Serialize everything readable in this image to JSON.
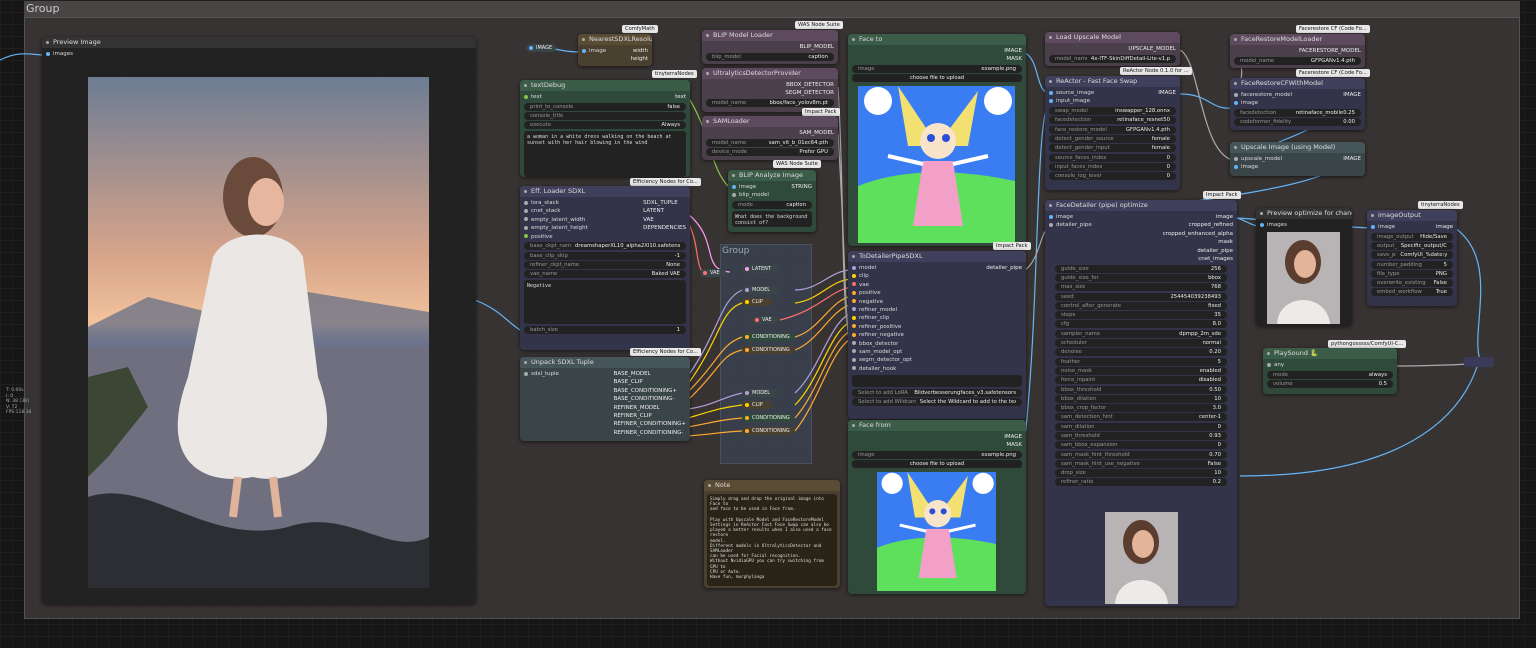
{
  "group_outer": "Group",
  "group_inner": "Group",
  "side_stats": [
    "T: 0.00s",
    "I: 0",
    "N: 38 [38]",
    "V: 72",
    "FPS:118.34"
  ],
  "preview_image": {
    "title": "Preview Image",
    "input": "images"
  },
  "nearest": {
    "title": "NearestSDXLResolution",
    "badge": "ComfyMath",
    "in_image": "image",
    "out_width": "width",
    "out_height": "height"
  },
  "image_reroute": "IMAGE",
  "textdebug": {
    "title": "textDebug",
    "badge": "tinyterraNodes",
    "in": "text",
    "out": "text",
    "widgets": [
      [
        "print_to_console",
        "false"
      ],
      [
        "console_title",
        ""
      ],
      [
        "execute",
        "Always"
      ]
    ],
    "text": "a woman in a white dress walking on the beach at sunset with her hair blowing in the wind"
  },
  "eff_loader": {
    "title": "Eff. Loader SDXL",
    "badge": "Efficiency Nodes for Co...",
    "inputs": [
      "lora_stack",
      "cnet_stack",
      "empty_latent_width",
      "empty_latent_height",
      "positive"
    ],
    "outputs": [
      "SDXL_TUPLE",
      "LATENT",
      "VAE",
      "DEPENDENCIES"
    ],
    "widgets": [
      [
        "base_ckpt_name",
        "dreamshaperXL10_alpha2Xl10.safetensors"
      ],
      [
        "base_clip_skip",
        "-1"
      ],
      [
        "refiner_ckpt_name",
        "None"
      ],
      [
        "vae_name",
        "Baked VAE"
      ]
    ],
    "negative": "Negative",
    "batch": [
      "batch_size",
      "1"
    ]
  },
  "unpack": {
    "title": "Unpack SDXL Tuple",
    "badge": "Efficiency Nodes for Co...",
    "input": "sdxl_tuple",
    "outputs": [
      "BASE_MODEL",
      "BASE_CLIP",
      "BASE_CONDITIONING+",
      "BASE_CONDITIONING-",
      "REFINER_MODEL",
      "REFINER_CLIP",
      "REFINER_CONDITIONING+",
      "REFINER_CONDITIONING-"
    ]
  },
  "vae_reroute": "VAE",
  "inner_reroutes": [
    "LATENT",
    "MODEL",
    "CLIP",
    "VAE",
    "CONDITIONING",
    "CONDITIONING",
    "MODEL",
    "CLIP",
    "CONDITIONING",
    "CONDITIONING"
  ],
  "blip_loader": {
    "title": "BLIP Model Loader",
    "badge": "WAS Node Suite",
    "out": "BLIP_MODEL",
    "widgets": [
      [
        "blip_model",
        "caption"
      ]
    ]
  },
  "ultra": {
    "title": "UltralyticsDetectorProvider",
    "outputs": [
      "BBOX_DETECTOR",
      "SEGM_DETECTOR"
    ],
    "widgets": [
      [
        "model_name",
        "bbox/face_yolov8m.pt"
      ]
    ],
    "badge": "Impact Pack"
  },
  "samloader": {
    "title": "SAMLoader",
    "out": "SAM_MODEL",
    "widgets": [
      [
        "model_name",
        "sam_vit_b_01ec64.pth"
      ],
      [
        "device_mode",
        "Prefer GPU"
      ]
    ],
    "badge": "WAS Node Suite"
  },
  "blip_analyze": {
    "title": "BLIP Analyze Image",
    "inputs": [
      "image",
      "blip_model"
    ],
    "out": "STRING",
    "widgets": [
      [
        "mode",
        "caption"
      ]
    ],
    "text": "What does the background consist of?"
  },
  "face_to": {
    "title": "Face to",
    "outputs": [
      "IMAGE",
      "MASK"
    ],
    "widget": [
      "image",
      "example.png"
    ],
    "button": "choose file to upload"
  },
  "todetailer": {
    "title": "ToDetailerPipeSDXL",
    "badge": "Impact Pack",
    "out": "detailer_pipe",
    "inputs": [
      "model",
      "clip",
      "vae",
      "positive",
      "negative",
      "refiner_model",
      "refiner_clip",
      "refiner_positive",
      "refiner_negative",
      "bbox_detector",
      "sam_model_opt",
      "segm_detector_opt",
      "detailer_hook"
    ],
    "widgets": [
      [
        "Select to add LoRA",
        "Bildverbesserungfaces_v3.safetensors"
      ],
      [
        "Select to add Wildcard",
        "Select the Wildcard to add to the text"
      ]
    ]
  },
  "face_from": {
    "title": "Face from",
    "outputs": [
      "IMAGE",
      "MASK"
    ],
    "widget": [
      "image",
      "example.png"
    ],
    "button": "choose file to upload"
  },
  "note": {
    "title": "Note",
    "text": "Simply drag and drop the original image into Face to\nand face to be used in Face from.\n\nPlay with Upscale Model and FaceRestoreModel\nSettings in ReActor Fast Face Swap can also be\nplayed a better results when I also used a face restore\nmodel.\nDifferent models in UltralyticsDetector and SAMLoader\ncan be used for Facial recognition.\nWithout NvidiaGPU you can try switching from GPU to\nCPU or Auto.\nHave fun, murphylanga"
  },
  "upscale_loader": {
    "title": "Load Upscale Model",
    "out": "UPSCALE_MODEL",
    "widgets": [
      [
        "model_name",
        "4x-ITF-SkinDiffDetail-Lite-v1.pth"
      ]
    ],
    "badge": "ReActor Node 0.1.0 for ..."
  },
  "reactor": {
    "title": "ReActor - Fast Face Swap",
    "inputs": [
      "source_image",
      "input_image"
    ],
    "out": "IMAGE",
    "widgets": [
      [
        "swap_model",
        "inswapper_128.onnx"
      ],
      [
        "facedetection",
        "retinaface_resnet50"
      ],
      [
        "face_restore_model",
        "GFPGANv1.4.pth"
      ],
      [
        "detect_gender_source",
        "female"
      ],
      [
        "detect_gender_input",
        "female"
      ],
      [
        "source_faces_index",
        "0"
      ],
      [
        "input_faces_index",
        "0"
      ],
      [
        "console_log_level",
        "0"
      ]
    ],
    "badge": "Impact Pack"
  },
  "fr_loader": {
    "title": "FaceRestoreModelLoader",
    "badge": "Facerestore CF (Code Fo...",
    "out": "FACERESTORE_MODEL",
    "widgets": [
      [
        "model_name",
        "GFPGANv1.4.pth"
      ]
    ]
  },
  "fr_cf": {
    "title": "FaceRestoreCFWithModel",
    "badge": "Facerestore CF (Code Fo...",
    "inputs": [
      "facerestore_model",
      "image"
    ],
    "out": "IMAGE",
    "widgets": [
      [
        "facedetection",
        "retinaface_mobile0.25"
      ],
      [
        "codeformer_fidelity",
        "0.00"
      ]
    ]
  },
  "upscale_image": {
    "title": "Upscale Image (using Model)",
    "inputs": [
      "upscale_model",
      "image"
    ],
    "out": "IMAGE"
  },
  "facedetailer": {
    "title": "FaceDetailer (pipe) optimize",
    "inputs": [
      "image",
      "detailer_pipe"
    ],
    "outputs": [
      "image",
      "cropped_refined",
      "cropped_enhanced_alpha",
      "mask",
      "detailer_pipe",
      "cnet_images"
    ],
    "widgets": [
      [
        "guide_size",
        "256"
      ],
      [
        "guide_size_for",
        "bbox"
      ],
      [
        "max_size",
        "768"
      ],
      [
        "seed",
        "254454039238493"
      ],
      [
        "control_after_generate",
        "fixed"
      ],
      [
        "steps",
        "35"
      ],
      [
        "cfg",
        "8.0"
      ],
      [
        "sampler_name",
        "dpmpp_2m_sde"
      ],
      [
        "scheduler",
        "normal"
      ],
      [
        "denoise",
        "0.20"
      ],
      [
        "feather",
        "5"
      ],
      [
        "noise_mask",
        "enabled"
      ],
      [
        "force_inpaint",
        "disabled"
      ],
      [
        "bbox_threshold",
        "0.50"
      ],
      [
        "bbox_dilation",
        "10"
      ],
      [
        "bbox_crop_factor",
        "3.0"
      ],
      [
        "sam_detection_hint",
        "center-1"
      ],
      [
        "sam_dilation",
        "0"
      ],
      [
        "sam_threshold",
        "0.93"
      ],
      [
        "sam_bbox_expansion",
        "0"
      ],
      [
        "sam_mask_hint_threshold",
        "0.70"
      ],
      [
        "sam_mask_hint_use_negative",
        "False"
      ],
      [
        "drop_size",
        "10"
      ],
      [
        "refiner_ratio",
        "0.2"
      ]
    ]
  },
  "preview_opt": {
    "title": "Preview optimize for change",
    "input": "images"
  },
  "image_output": {
    "title": "imageOutput",
    "badge": "tinyterraNodes",
    "in": "image",
    "out": "image",
    "widgets": [
      [
        "image_output",
        "Hide/Save"
      ],
      [
        "output_path",
        "Specific_output/ComfyUI/mu"
      ],
      [
        "save_prefix",
        "ComfyUI_%date:yyyy-MM-d"
      ],
      [
        "number_padding",
        "5"
      ],
      [
        "file_type",
        "PNG"
      ],
      [
        "overwrite_existing",
        "False"
      ],
      [
        "embed_workflow",
        "True"
      ]
    ]
  },
  "playsound": {
    "title": "PlaySound 🐍",
    "badge": "pythongosssss/ComfyUI-C...",
    "in": "any",
    "widgets": [
      [
        "mode",
        "always"
      ],
      [
        "volume",
        "0.5"
      ]
    ]
  },
  "colors": {
    "image": "#64b5f6",
    "model": "#b39ddb",
    "clip": "#ffd500",
    "vae": "#ff6e6e",
    "cond": "#ffa931",
    "latent": "#ff9cf9",
    "string": "#8bc34a",
    "pipe": "#aaaaaa"
  }
}
